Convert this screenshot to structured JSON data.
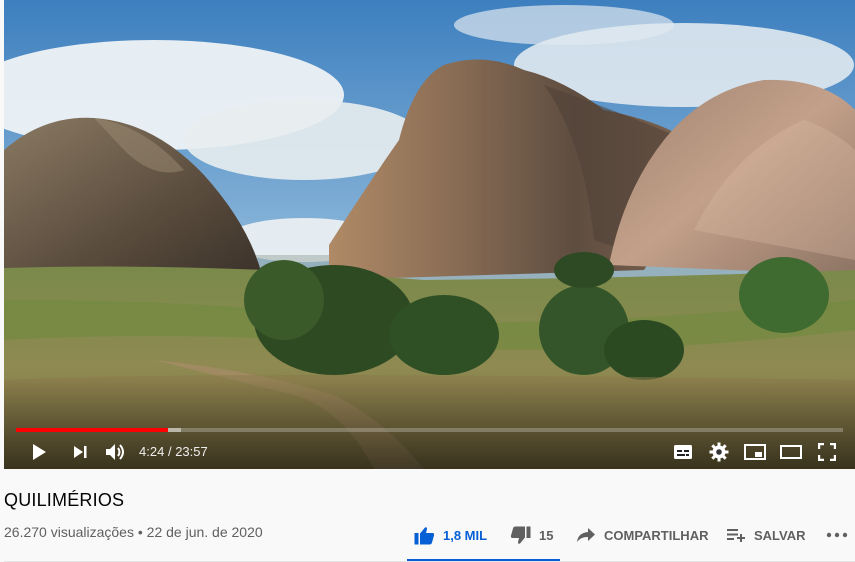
{
  "player": {
    "current_time": "4:24",
    "separator": "/",
    "duration": "23:57",
    "progress_played": 0.184,
    "progress_buffered": 0.2,
    "accent": "#ff0000"
  },
  "video": {
    "title": "QUILIMÉRIOS",
    "views": "26.270 visualizações",
    "dot": "•",
    "date": "22 de jun. de 2020"
  },
  "actions": {
    "like_count": "1,8 MIL",
    "dislike_count": "15",
    "share_label": "COMPARTILHAR",
    "save_label": "SALVAR",
    "like_color": "#065fd4"
  },
  "icons": [
    "play-icon",
    "next-icon",
    "volume-icon",
    "subtitles-icon",
    "settings-icon",
    "miniplayer-icon",
    "theater-icon",
    "fullscreen-icon",
    "thumbs-up-icon",
    "thumbs-down-icon",
    "share-icon",
    "playlist-add-icon",
    "more-icon"
  ]
}
